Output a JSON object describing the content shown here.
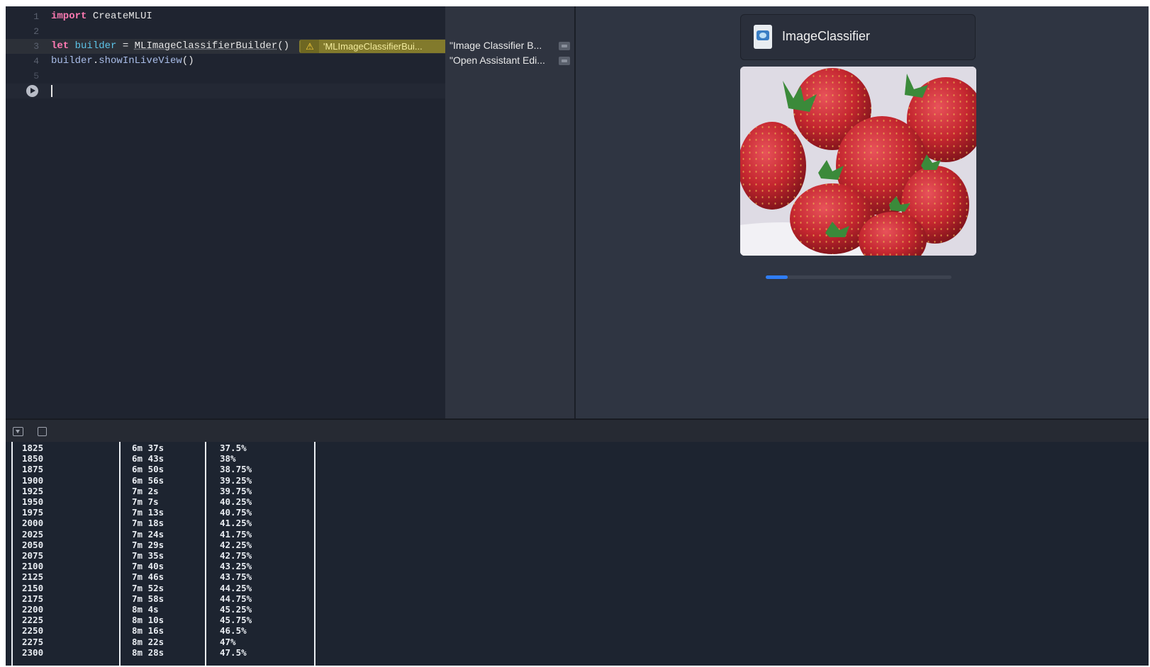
{
  "editor": {
    "lines": [
      {
        "num": "1",
        "kw": "import",
        "rest": " CreateMLUI"
      },
      {
        "num": "2"
      },
      {
        "num": "3",
        "kw": "let",
        "var": "builder",
        "op": " = ",
        "type": "MLImageClassifierBuilder",
        "punct": "()"
      },
      {
        "num": "4",
        "obj": "builder",
        "dot": ".",
        "call": "showInLiveView",
        "punct": "()"
      },
      {
        "num": "5"
      }
    ],
    "warning_text": "'MLImageClassifierBui...",
    "warning_icon": "warning-triangle-icon",
    "run_icon": "play-circle-icon"
  },
  "results": [
    {
      "text": "\"Image Classifier B..."
    },
    {
      "text": "\"Open Assistant Edi..."
    }
  ],
  "live_view": {
    "title": "ImageClassifier",
    "doc_icon": "mlmodel-document-icon",
    "image_alt": "strawberries",
    "progress": 0.12,
    "accent": "#2f7df6"
  },
  "console": {
    "toggle_icon": "hide-console-icon",
    "clear_icon": "clear-console-icon",
    "rows": [
      [
        "1825",
        "6m 37s",
        "37.5%"
      ],
      [
        "1850",
        "6m 43s",
        "38%"
      ],
      [
        "1875",
        "6m 50s",
        "38.75%"
      ],
      [
        "1900",
        "6m 56s",
        "39.25%"
      ],
      [
        "1925",
        "7m 2s",
        "39.75%"
      ],
      [
        "1950",
        "7m 7s",
        "40.25%"
      ],
      [
        "1975",
        "7m 13s",
        "40.75%"
      ],
      [
        "2000",
        "7m 18s",
        "41.25%"
      ],
      [
        "2025",
        "7m 24s",
        "41.75%"
      ],
      [
        "2050",
        "7m 29s",
        "42.25%"
      ],
      [
        "2075",
        "7m 35s",
        "42.75%"
      ],
      [
        "2100",
        "7m 40s",
        "43.25%"
      ],
      [
        "2125",
        "7m 46s",
        "43.75%"
      ],
      [
        "2150",
        "7m 52s",
        "44.25%"
      ],
      [
        "2175",
        "7m 58s",
        "44.75%"
      ],
      [
        "2200",
        "8m 4s",
        "45.25%"
      ],
      [
        "2225",
        "8m 10s",
        "45.75%"
      ],
      [
        "2250",
        "8m 16s",
        "46.5%"
      ],
      [
        "2275",
        "8m 22s",
        "47%"
      ],
      [
        "2300",
        "8m 28s",
        "47.5%"
      ]
    ]
  }
}
